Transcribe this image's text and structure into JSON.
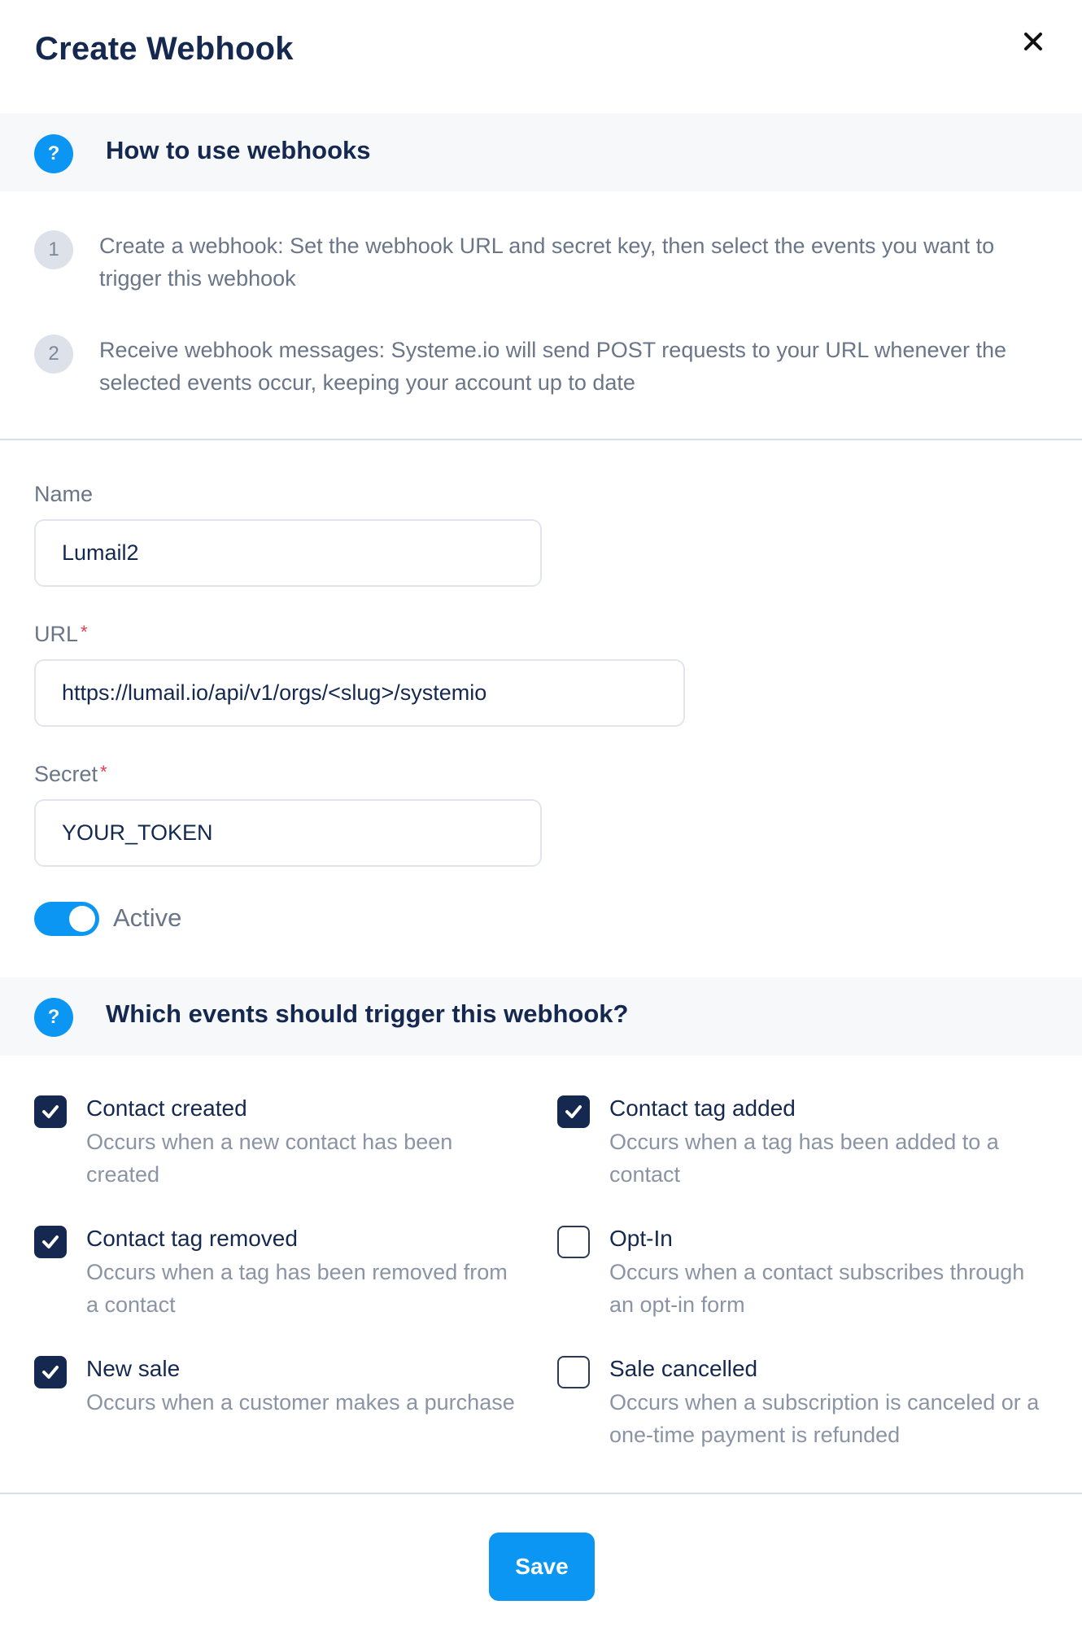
{
  "header": {
    "title": "Create Webhook",
    "close_icon": "close-icon"
  },
  "how_to": {
    "icon": "help-icon",
    "title": "How to use webhooks",
    "steps": [
      {
        "number": "1",
        "text": "Create a webhook: Set the webhook URL and secret key, then select the events you want to trigger this webhook"
      },
      {
        "number": "2",
        "text": "Receive webhook messages: Systeme.io will send POST requests to your URL whenever the selected events occur, keeping your account up to date"
      }
    ]
  },
  "form": {
    "name": {
      "label": "Name",
      "value": "Lumail2"
    },
    "url": {
      "label": "URL",
      "required_mark": "*",
      "value": "https://lumail.io/api/v1/orgs/<slug>/systemio"
    },
    "secret": {
      "label": "Secret",
      "required_mark": "*",
      "value": "YOUR_TOKEN"
    },
    "active": {
      "label": "Active",
      "enabled": true
    }
  },
  "events": {
    "icon": "help-icon",
    "title": "Which events should trigger this webhook?",
    "items": [
      {
        "title": "Contact created",
        "description": "Occurs when a new contact has been created",
        "checked": true
      },
      {
        "title": "Contact tag added",
        "description": "Occurs when a tag has been added to a contact",
        "checked": true
      },
      {
        "title": "Contact tag removed",
        "description": "Occurs when a tag has been removed from a contact",
        "checked": true
      },
      {
        "title": "Opt-In",
        "description": "Occurs when a contact subscribes through an opt-in form",
        "checked": false
      },
      {
        "title": "New sale",
        "description": "Occurs when a customer makes a purchase",
        "checked": true
      },
      {
        "title": "Sale cancelled",
        "description": "Occurs when a subscription is canceled or a one-time payment is refunded",
        "checked": false
      }
    ]
  },
  "footer": {
    "save_label": "Save"
  },
  "colors": {
    "accent": "#0b96f4",
    "navy": "#142850",
    "required": "#e53a4c"
  }
}
